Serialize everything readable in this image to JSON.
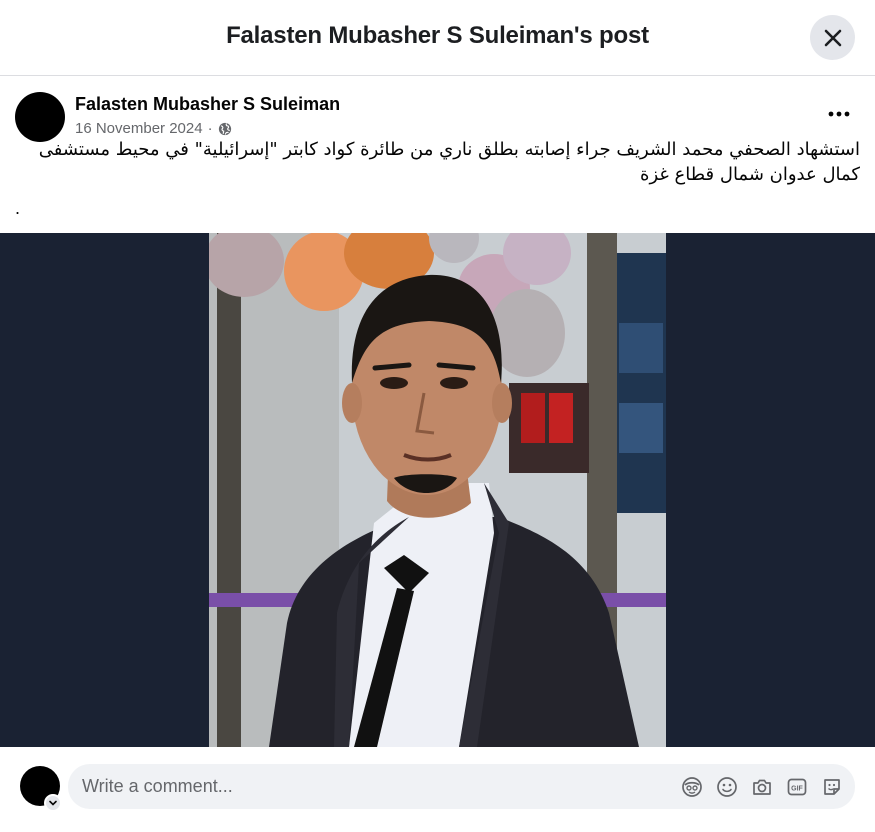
{
  "header": {
    "title": "Falasten Mubasher S Suleiman's post"
  },
  "post": {
    "author": "Falasten Mubasher S Suleiman",
    "date": "16 November 2024",
    "separator": "·",
    "privacy_icon": "globe-icon",
    "more_icon": "more-options-icon",
    "text": "استشهاد الصحفي محمد الشريف جراء إصابته بطلق ناري من طائرة كواد كابتر \"إسرائيلية\" في محيط مستشفى كمال عدوان شمال قطاع غزة",
    "trailing_dot": "."
  },
  "media": {
    "alt": "Photo of a man in a dark suit, white shirt and black tie"
  },
  "comment": {
    "placeholder": "Write a comment...",
    "icons": [
      "avatar-sticker-icon",
      "emoji-icon",
      "camera-icon",
      "gif-icon",
      "sticker-icon"
    ]
  },
  "colors": {
    "header_button_bg": "#e4e6eb",
    "comment_box_bg": "#f0f2f5",
    "media_bg": "#1a2233",
    "secondary_text": "#65676b"
  }
}
